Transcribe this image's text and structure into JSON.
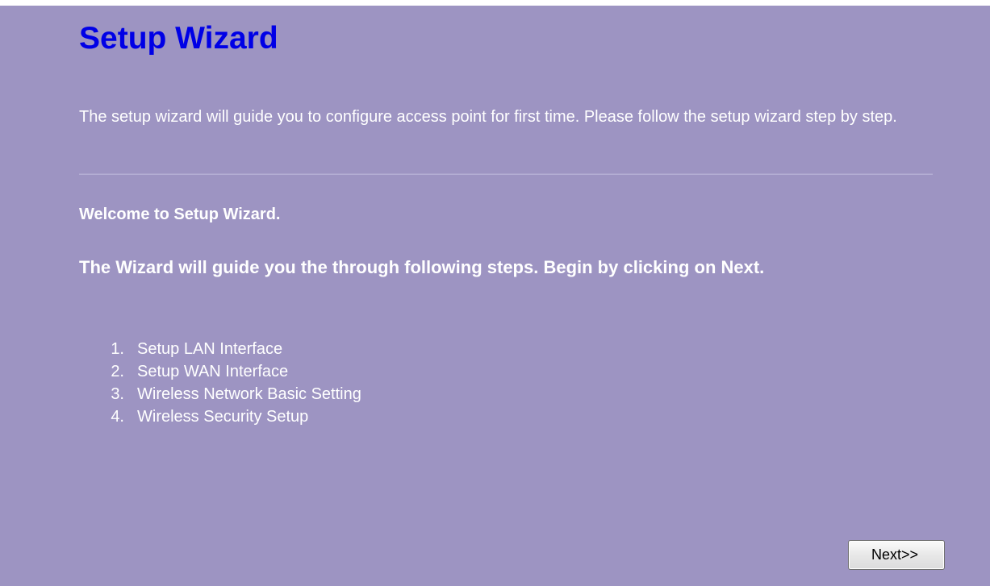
{
  "page": {
    "title": "Setup Wizard",
    "intro": "The setup wizard will guide you to configure access point for first time. Please follow the setup wizard step by step.",
    "welcome": "Welcome to Setup Wizard.",
    "guide": "The Wizard will guide you the through following steps. Begin by clicking on Next.",
    "steps": [
      {
        "num": "1.",
        "label": "Setup LAN Interface"
      },
      {
        "num": "2.",
        "label": "Setup WAN Interface"
      },
      {
        "num": "3.",
        "label": "Wireless Network Basic Setting"
      },
      {
        "num": "4.",
        "label": "Wireless Security Setup"
      }
    ],
    "next_label": "Next>>"
  },
  "colors": {
    "background": "#9d94c2",
    "title": "#0000e6",
    "text": "#ffffff"
  }
}
